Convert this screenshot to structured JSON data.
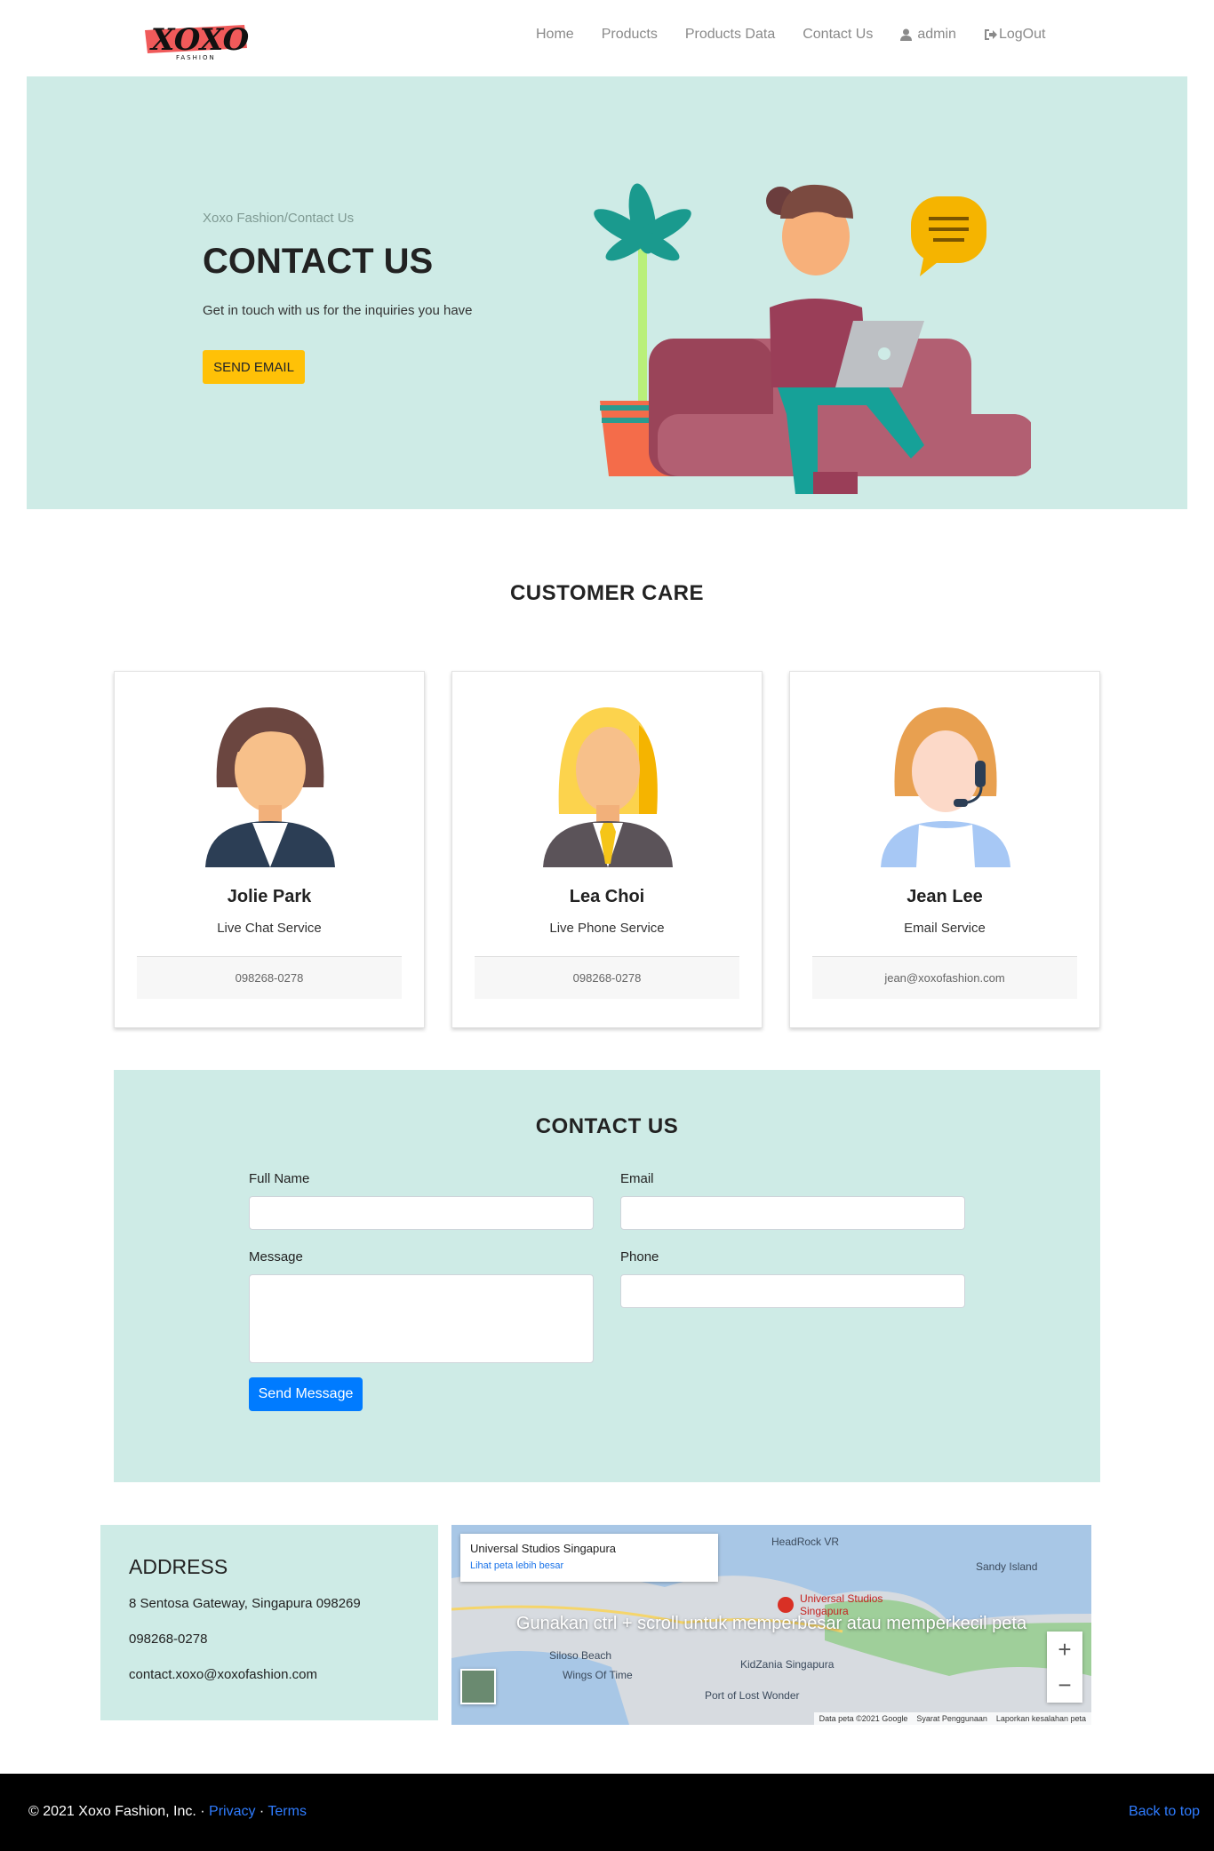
{
  "nav": {
    "logo_text": "XOXO",
    "logo_sub": "FASHION",
    "links": [
      "Home",
      "Products",
      "Products Data",
      "Contact Us"
    ],
    "user": "admin",
    "logout": "LogOut"
  },
  "hero": {
    "breadcrumb": "Xoxo Fashion/Contact Us",
    "title": "CONTACT US",
    "subtitle": "Get in touch with us for the inquiries you have",
    "button": "SEND EMAIL",
    "bg_color": "#ceebe6",
    "accent": "#ffc107"
  },
  "care": {
    "title": "CUSTOMER CARE",
    "agents": [
      {
        "name": "Jolie Park",
        "role": "Live Chat Service",
        "contact": "098268-0278",
        "avatar": "woman-brown-hair-avatar"
      },
      {
        "name": "Lea Choi",
        "role": "Live Phone Service",
        "contact": "098268-0278",
        "avatar": "woman-blonde-avatar"
      },
      {
        "name": "Jean Lee",
        "role": "Email Service",
        "contact": "jean@xoxofashion.com",
        "avatar": "woman-headset-avatar"
      }
    ]
  },
  "form": {
    "title": "CONTACT US",
    "full_name": "Full Name",
    "email": "Email",
    "message": "Message",
    "phone": "Phone",
    "submit": "Send Message",
    "submit_color": "#007bff"
  },
  "address": {
    "title": "ADDRESS",
    "street": "8 Sentosa Gateway, Singapura 098269",
    "phone": "098268-0278",
    "email": "contact.xoxo@xoxofashion.com"
  },
  "map": {
    "place": "Universal Studios Singapura",
    "link": "Lihat peta lebih besar",
    "overlay": "Gunakan ctrl + scroll untuk memperbesar atau memperkecil peta",
    "labels": [
      "HeadRock VR",
      "Sandy Island",
      "Universal Studios Singapura",
      "KidZania Singapura",
      "Siloso Beach",
      "Wings Of Time",
      "Port of Lost Wonder"
    ],
    "attribution": [
      "Data peta ©2021 Google",
      "Syarat Penggunaan",
      "Laporkan kesalahan peta"
    ]
  },
  "footer": {
    "copyright": "© 2021 Xoxo Fashion, Inc. · ",
    "privacy": "Privacy",
    "dot": " · ",
    "terms": "Terms",
    "back": "Back to top"
  }
}
